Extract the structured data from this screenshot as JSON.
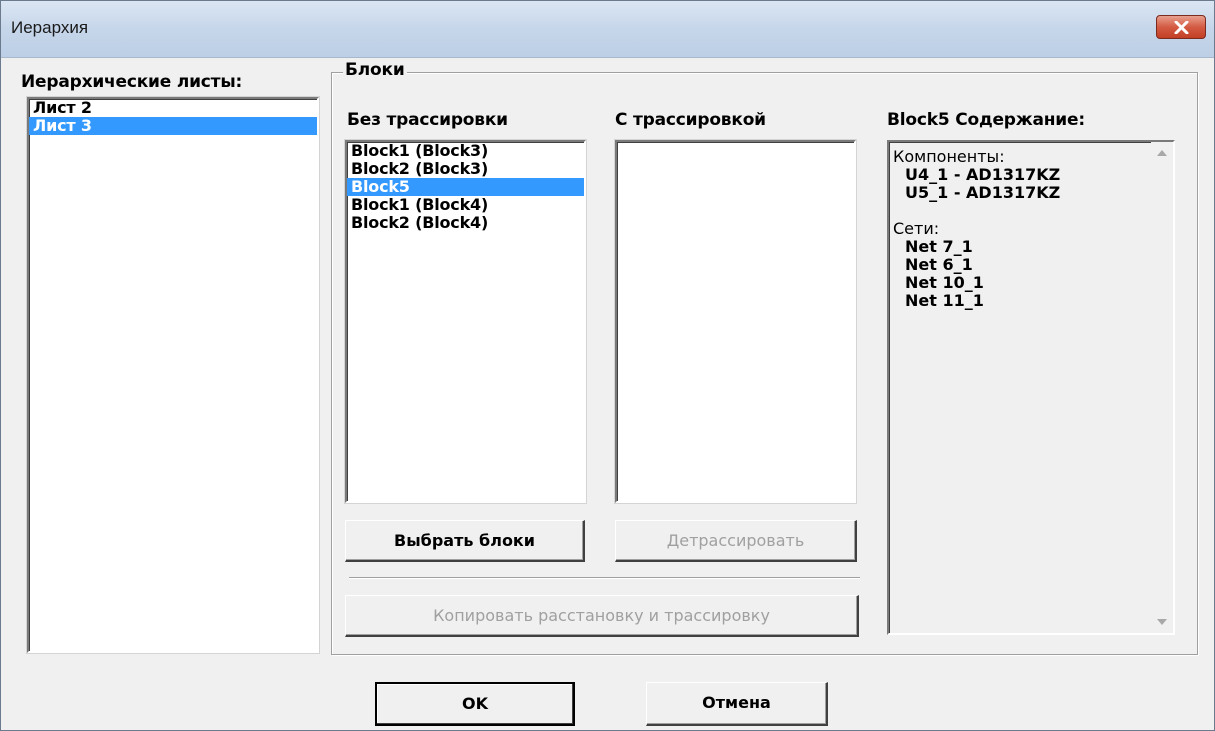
{
  "window": {
    "title": "Иерархия",
    "close_icon": "close-icon"
  },
  "sheets": {
    "label": "Иерархические листы:",
    "items": [
      "Лист 2",
      "Лист 3"
    ],
    "selected_index": 1
  },
  "blocks": {
    "group_label": "Блоки",
    "untraced": {
      "label": "Без трассировки",
      "items": [
        "Block1 (Block3)",
        "Block2 (Block3)",
        "Block5",
        "Block1 (Block4)",
        "Block2 (Block4)"
      ],
      "selected_index": 2
    },
    "traced": {
      "label": "С трассировкой",
      "items": []
    },
    "select_button": "Выбрать блоки",
    "untrace_button": "Детрассировать",
    "copy_button": "Копировать расстановку и трассировку"
  },
  "content": {
    "label": "Block5 Содержание:",
    "components_heading": "Компоненты:",
    "components": [
      "U4_1 - AD1317KZ",
      "U5_1 - AD1317KZ"
    ],
    "nets_heading": "Сети:",
    "nets": [
      "Net 7_1",
      "Net 6_1",
      "Net 10_1",
      "Net 11_1"
    ]
  },
  "buttons": {
    "ok": "OK",
    "cancel": "Отмена"
  },
  "colors": {
    "selection": "#3399ff",
    "window_bg": "#f0f0f0",
    "close_button": "#c94a31"
  }
}
